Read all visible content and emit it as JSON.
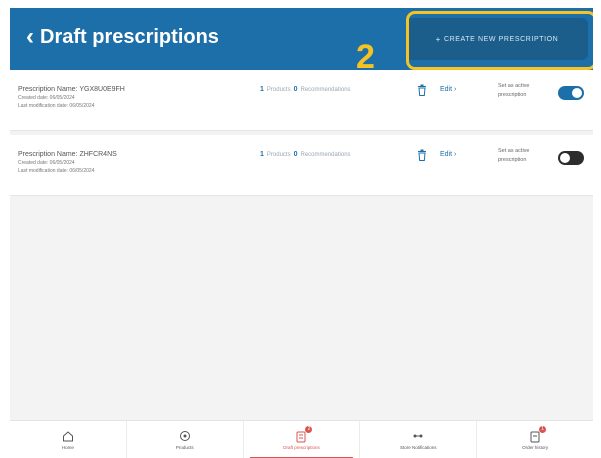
{
  "header": {
    "back_label": "Draft prescriptions",
    "create_button_label": "CREATE NEW PRESCRIPTION",
    "step_number": "2"
  },
  "prescriptions": [
    {
      "name": "Prescription Name: YGX8U0E9FH",
      "created": "Created date: 06/05/2024",
      "modified": "Last modification date: 06/05/2024",
      "count_a": "1",
      "count_a_label": "Products",
      "count_b": "0",
      "count_b_label": "Recommendations",
      "edit_label": "Edit",
      "active_label_line1": "Set as active",
      "active_label_line2": "prescription",
      "active": true
    },
    {
      "name": "Prescription Name: ZHFCR4NS",
      "created": "Created date: 06/05/2024",
      "modified": "Last modification date: 06/05/2024",
      "count_a": "1",
      "count_a_label": "Products",
      "count_b": "0",
      "count_b_label": "Recommendations",
      "edit_label": "Edit",
      "active_label_line1": "Set as active",
      "active_label_line2": "prescription",
      "active": false
    }
  ],
  "bottom_nav": [
    {
      "label": "Home",
      "icon": "home-icon"
    },
    {
      "label": "Products",
      "icon": "catalog-icon"
    },
    {
      "label": "Draft prescriptions",
      "icon": "draft-icon",
      "active": true,
      "badge": "2"
    },
    {
      "label": "Store Notifications",
      "icon": "notification-icon"
    },
    {
      "label": "Order history",
      "icon": "order-icon",
      "badge": "1"
    }
  ],
  "colors": {
    "header_bg": "#1c6fa8",
    "button_bg": "#1b5d8b",
    "highlight": "#f6c324",
    "active_nav": "#d9534f"
  }
}
